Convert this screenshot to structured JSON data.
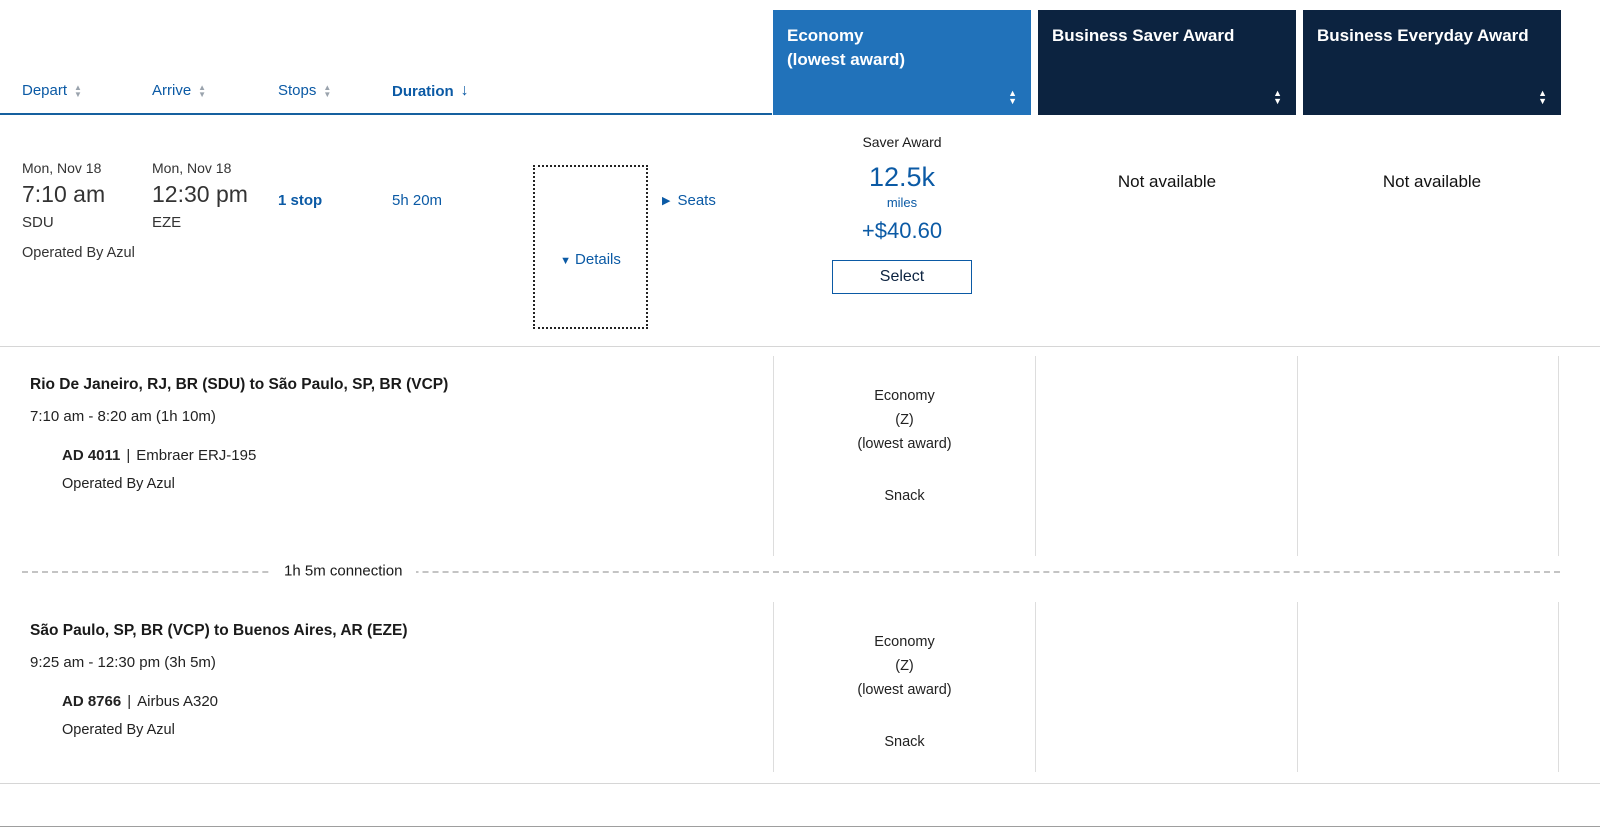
{
  "icons": {
    "caret_up": "▲",
    "caret_down": "▼",
    "sort_desc": "↓",
    "details_caret": "▼",
    "seats_caret": "▶"
  },
  "colors": {
    "economy_header_bg": "#2172ba",
    "business_header_bg": "#0c2340",
    "link_blue": "#0b5aa5",
    "header_underline": "#15609f"
  },
  "sort_headers": [
    {
      "label": "Depart"
    },
    {
      "label": "Arrive"
    },
    {
      "label": "Stops"
    },
    {
      "label": "Duration"
    }
  ],
  "fare_headers": [
    {
      "label": "Economy",
      "sublabel": "(lowest award)"
    },
    {
      "label": "Business Saver Award",
      "sublabel": ""
    },
    {
      "label": "Business Everyday Award",
      "sublabel": ""
    }
  ],
  "flight": {
    "depart_date": "Mon, Nov 18",
    "depart_time": "7:10 am",
    "depart_airport": "SDU",
    "arrive_date": "Mon, Nov 18",
    "arrive_time": "12:30 pm",
    "arrive_airport": "EZE",
    "operated_by": "Operated By Azul",
    "stops": "1 stop",
    "duration": "5h 20m",
    "details_label": "Details",
    "seats_label": "Seats"
  },
  "economy_fare": {
    "award_type": "Saver Award",
    "miles": "12.5k",
    "miles_unit": "miles",
    "cash": "+$40.60",
    "select_label": "Select"
  },
  "business_saver": {
    "availability": "Not available"
  },
  "business_everyday": {
    "availability": "Not available"
  },
  "details": {
    "connection": "1h 5m connection",
    "segments": [
      {
        "route": "Rio De Janeiro, RJ, BR (SDU) to São Paulo, SP, BR (VCP)",
        "times": "7:10 am - 8:20 am (1h 10m)",
        "flight_number": "AD 4011",
        "separator": "|",
        "aircraft": "Embraer ERJ-195",
        "operated_by": "Operated By Azul",
        "cabin_line1": "Economy",
        "cabin_line2": "(Z)",
        "cabin_line3": "(lowest award)",
        "amenity": "Snack"
      },
      {
        "route": "São Paulo, SP, BR (VCP) to Buenos Aires, AR (EZE)",
        "times": "9:25 am - 12:30 pm (3h 5m)",
        "flight_number": "AD 8766",
        "separator": "|",
        "aircraft": "Airbus A320",
        "operated_by": "Operated By Azul",
        "cabin_line1": "Economy",
        "cabin_line2": "(Z)",
        "cabin_line3": "(lowest award)",
        "amenity": "Snack"
      }
    ]
  }
}
